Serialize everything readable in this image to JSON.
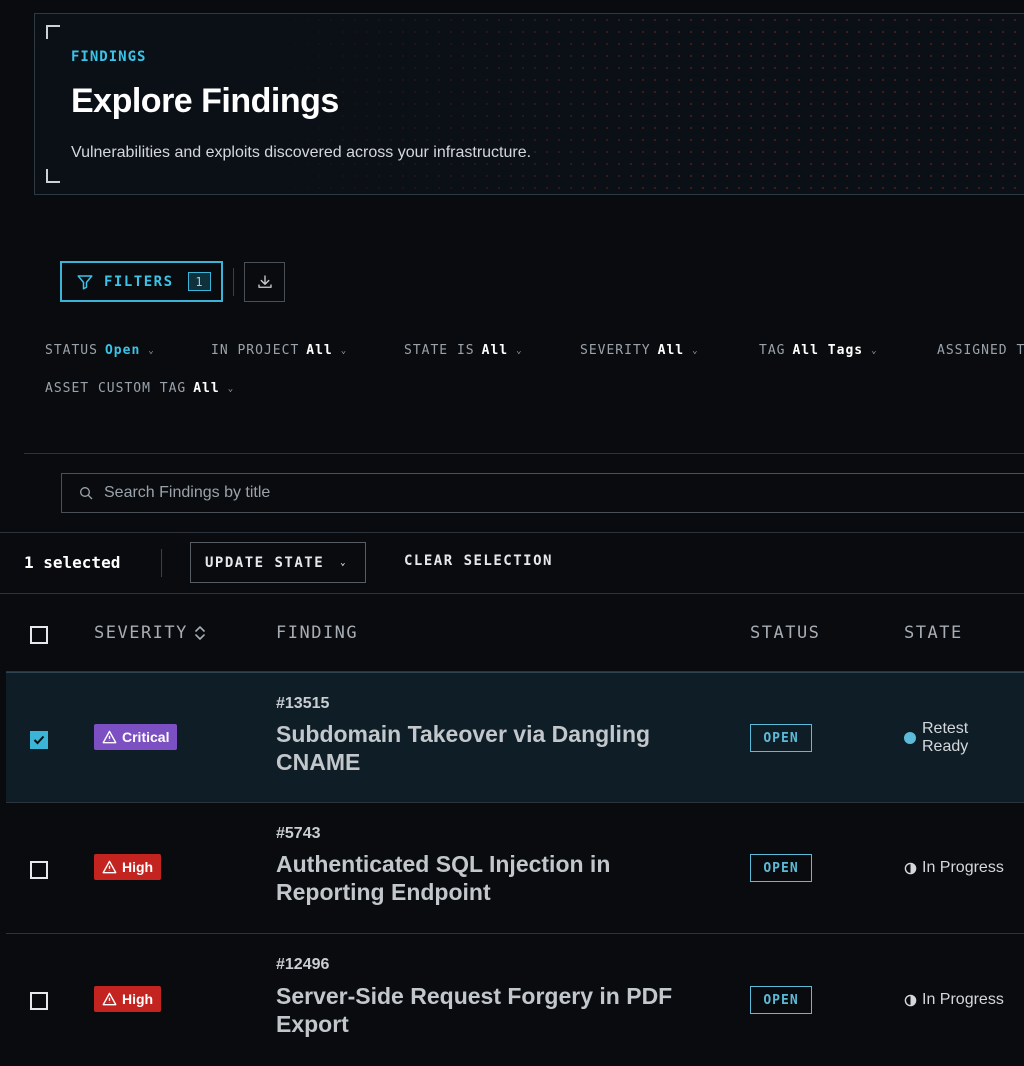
{
  "header": {
    "eyebrow": "FINDINGS",
    "title": "Explore Findings",
    "subtitle": "Vulnerabilities and exploits discovered across your infrastructure."
  },
  "toolbar": {
    "filters_label": "FILTERS",
    "filters_count": "1",
    "download_icon": "download-icon"
  },
  "filter_chips": [
    {
      "label": "STATUS",
      "value": "Open"
    },
    {
      "label": "IN PROJECT",
      "value": "All"
    },
    {
      "label": "STATE IS",
      "value": "All"
    },
    {
      "label": "SEVERITY",
      "value": "All"
    },
    {
      "label": "TAG",
      "value": "All Tags"
    },
    {
      "label": "ASSIGNED T"
    },
    {
      "label": "ASSET CUSTOM TAG",
      "value": "All"
    }
  ],
  "search": {
    "placeholder": "Search Findings by title"
  },
  "selection_bar": {
    "selected_text": "1 selected",
    "update_state_label": "UPDATE STATE",
    "clear_label": "CLEAR SELECTION"
  },
  "table": {
    "columns": [
      "SEVERITY",
      "FINDING",
      "STATUS",
      "STATE"
    ],
    "rows": [
      {
        "checked": true,
        "severity": "Critical",
        "id": "#13515",
        "title": "Subdomain Takeover via Dangling CNAME",
        "status": "OPEN",
        "state": "Retest Ready",
        "state_icon": "filled-circle-icon"
      },
      {
        "checked": false,
        "severity": "High",
        "id": "#5743",
        "title": "Authenticated SQL Injection in Reporting Endpoint",
        "status": "OPEN",
        "state": "In Progress",
        "state_icon": "half-circle-icon"
      },
      {
        "checked": false,
        "severity": "High",
        "id": "#12496",
        "title": "Server-Side Request Forgery in PDF Export",
        "status": "OPEN",
        "state": "In Progress",
        "state_icon": "half-circle-icon"
      }
    ]
  },
  "colors": {
    "accent": "#3bc3e8",
    "critical": "#7c4fc2",
    "high": "#c4241f",
    "background": "#0a0b0e"
  }
}
